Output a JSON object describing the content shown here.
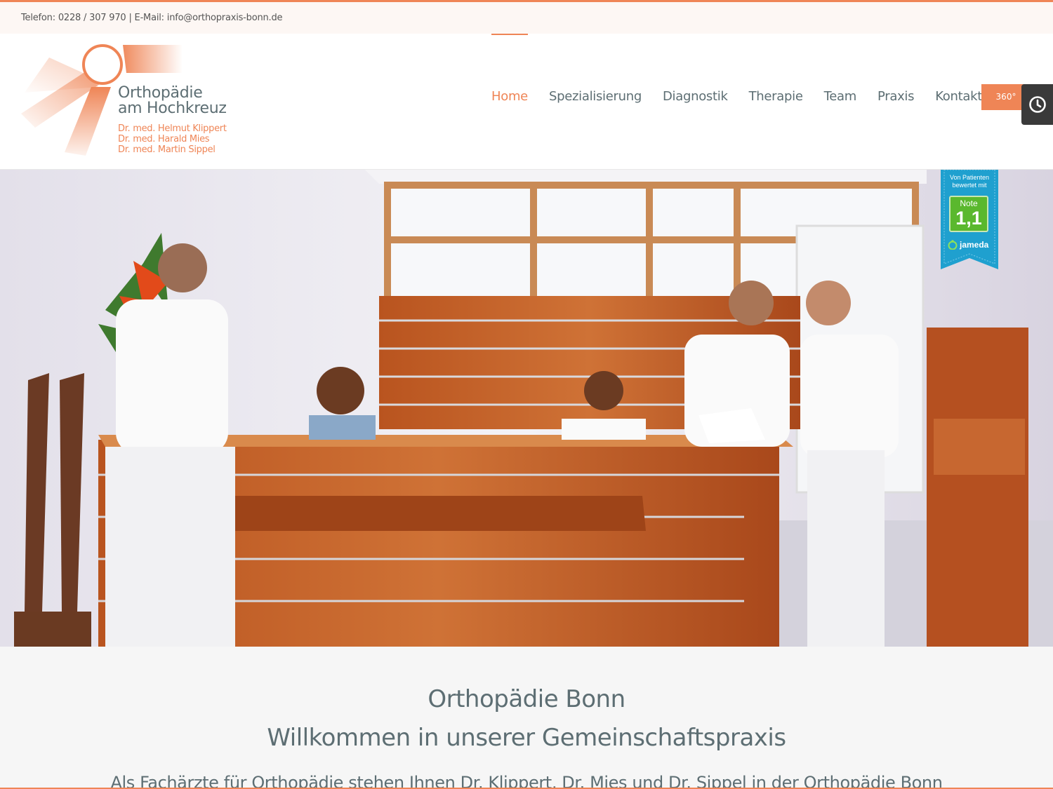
{
  "topbar": {
    "contact": "Telefon: 0228 / 307 970 | E-Mail: info@orthopraxis-bonn.de"
  },
  "logo": {
    "title_line1": "Orthopädie",
    "title_line2": "am Hochkreuz",
    "doctors": [
      "Dr. med. Helmut Klippert",
      "Dr. med. Harald Mies",
      "Dr. med. Martin Sippel"
    ]
  },
  "nav": {
    "items": [
      {
        "label": "Home",
        "active": true
      },
      {
        "label": "Spezialisierung"
      },
      {
        "label": "Diagnostik"
      },
      {
        "label": "Therapie"
      },
      {
        "label": "Team"
      },
      {
        "label": "Praxis"
      },
      {
        "label": "Kontakt"
      }
    ],
    "button_360": "360°"
  },
  "side_tab": {
    "icon": "clock-icon"
  },
  "badge": {
    "top_text_line1": "Von Patienten",
    "top_text_line2": "bewertet mit",
    "note_label": "Note",
    "grade": "1,1",
    "brand": "jameda"
  },
  "content": {
    "heading_line1": "Orthopädie Bonn",
    "heading_line2": "Willkommen in unserer Gemeinschaftspraxis",
    "intro": "Als Fachärzte für Orthopädie stehen Ihnen Dr. Klippert, Dr. Mies und Dr. Sippel in der Orthopädie Bonn"
  },
  "colors": {
    "accent": "#ef8556",
    "text": "#5d6e73",
    "dark_tab": "#3a3a3a",
    "badge_blue": "#1fa0cf",
    "badge_green": "#5ab82e"
  }
}
